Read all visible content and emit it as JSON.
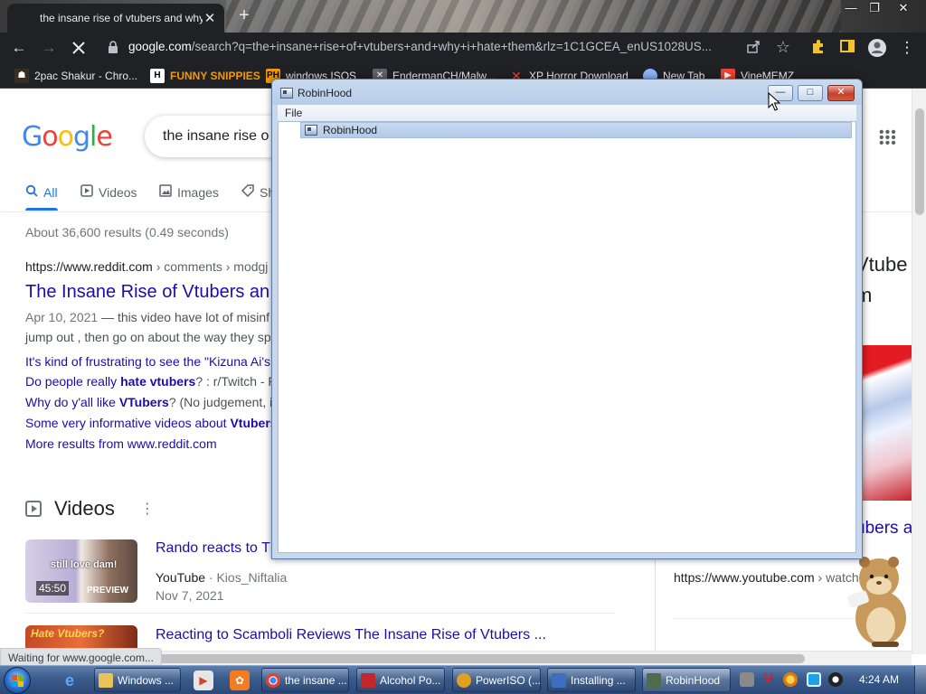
{
  "browser": {
    "tab_title": "the insane rise of vtubers and why i hate them",
    "tab_close": "✕",
    "new_tab": "+",
    "url_domain": "google.com",
    "url_rest": "/search?q=the+insane+rise+of+vtubers+and+why+i+hate+them&rlz=1C1GCEA_enUS1028US...",
    "status_text": "Waiting for www.google.com...",
    "bookmarks": [
      {
        "label": "2pac Shakur - Chro..."
      },
      {
        "label": "FUNNY SNIPPIES"
      },
      {
        "label": "windows ISOS"
      },
      {
        "label": "EndermanCH/Malw..."
      },
      {
        "label": "XP Horror Download"
      },
      {
        "label": "New Tab"
      },
      {
        "label": "VineMEMZ"
      }
    ]
  },
  "google": {
    "logo": [
      "G",
      "o",
      "o",
      "g",
      "l",
      "e"
    ],
    "query": "the insane rise o",
    "tabs": [
      {
        "label": "All"
      },
      {
        "label": "Videos"
      },
      {
        "label": "Images"
      },
      {
        "label": "Sh"
      }
    ],
    "result_stats": "About 36,600 results (0.49 seconds)",
    "result": {
      "cite_domain": "https://www.reddit.com",
      "cite_path": " › comments › modgj",
      "title": "The Insane Rise of Vtubers an",
      "date": "Apr 10, 2021",
      "snippet1": " — this video have lot of misinf",
      "snippet2": "jump out , then go on about the way they sp",
      "sublinks": [
        {
          "pre": "It's kind of frustrating to see the \"Kizuna Ai's",
          "bold": "",
          "post": ""
        },
        {
          "pre": "Do people really ",
          "bold": "hate vtubers",
          "post": "? : r/Twitch - R"
        },
        {
          "pre": "Why do y'all like ",
          "bold": "VTubers",
          "post": "? (No judgement, i"
        },
        {
          "pre": "Some very informative videos about ",
          "bold": "Vtubers",
          "post": ""
        },
        {
          "pre": "More results from www.reddit.com",
          "bold": "",
          "post": ""
        }
      ]
    },
    "videos_heading": "Videos",
    "videos": [
      {
        "title": "Rando reacts to T",
        "source": "YouTube",
        "channel": " · Kios_Niftalia",
        "date": "Nov 7, 2021",
        "duration": "45:50",
        "preview": "PREVIEW",
        "thumb_text": "still love dam!"
      },
      {
        "title": "Reacting to Scamboli Reviews The Insane Rise of Vtubers ...",
        "thumb_text": "Hate Vtubers?"
      }
    ],
    "knowledge_panel": {
      "title_line1": "Vtube",
      "title_line2": "m",
      "title_line3": "ubers ar",
      "cite_domain": "https://www.youtube.com",
      "cite_path": " › watch"
    }
  },
  "robinhood": {
    "title": "RobinHood",
    "menu": [
      {
        "label": "File"
      }
    ],
    "tree_item": "RobinHood",
    "buttons": {
      "minimize": "—",
      "maximize": "□",
      "close": "✕"
    }
  },
  "taskbar": {
    "items": [
      {
        "label": "Windows ...",
        "color": "#e8c25a"
      },
      {
        "label": "the insane ...",
        "color": "#dd4b39"
      },
      {
        "label": "Alcohol Po...",
        "color": "#c0282d"
      },
      {
        "label": "PowerISO (...",
        "color": "#e0a020"
      },
      {
        "label": "Installing ...",
        "color": "#3c6fc0"
      },
      {
        "label": "RobinHood",
        "color": "#4f6b4a"
      }
    ],
    "clock": "4:24 AM"
  },
  "colors": {
    "chrome_dark": "#202124",
    "google_link": "#1a0dab",
    "google_blue": "#1a73e8",
    "taskbar_blue": "#3b5b8a"
  }
}
